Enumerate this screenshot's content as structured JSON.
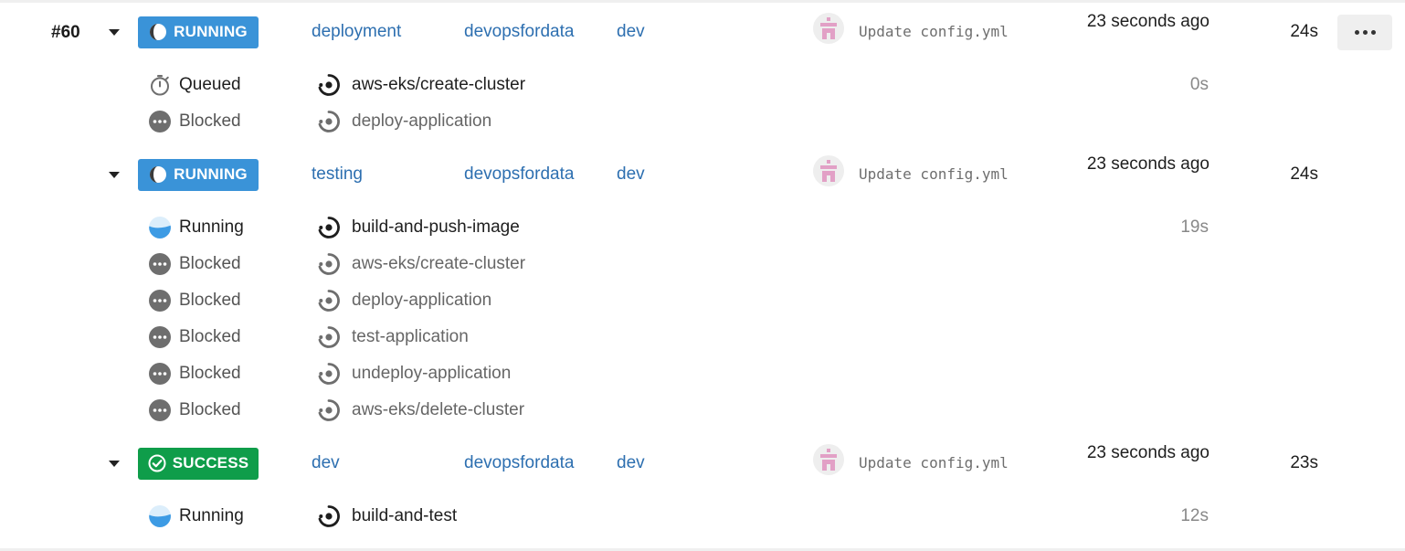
{
  "pipeline": {
    "number": "#60"
  },
  "workflows": [
    {
      "status": "RUNNING",
      "status_type": "running",
      "name": "deployment",
      "project": "devopsfordata",
      "branch": "dev",
      "commit_message": "Update config.yml",
      "time_ago": "23 seconds ago",
      "duration": "24s",
      "jobs": [
        {
          "status": "Queued",
          "status_icon": "stopwatch-icon",
          "name": "aws-eks/create-cluster",
          "duration": "0s",
          "active": true
        },
        {
          "status": "Blocked",
          "status_icon": "dots-circle-icon",
          "name": "deploy-application",
          "duration": "",
          "active": false
        }
      ]
    },
    {
      "status": "RUNNING",
      "status_type": "running",
      "name": "testing",
      "project": "devopsfordata",
      "branch": "dev",
      "commit_message": "Update config.yml",
      "time_ago": "23 seconds ago",
      "duration": "24s",
      "jobs": [
        {
          "status": "Running",
          "status_icon": "running-circle-icon",
          "name": "build-and-push-image",
          "duration": "19s",
          "active": true
        },
        {
          "status": "Blocked",
          "status_icon": "dots-circle-icon",
          "name": "aws-eks/create-cluster",
          "duration": "",
          "active": false
        },
        {
          "status": "Blocked",
          "status_icon": "dots-circle-icon",
          "name": "deploy-application",
          "duration": "",
          "active": false
        },
        {
          "status": "Blocked",
          "status_icon": "dots-circle-icon",
          "name": "test-application",
          "duration": "",
          "active": false
        },
        {
          "status": "Blocked",
          "status_icon": "dots-circle-icon",
          "name": "undeploy-application",
          "duration": "",
          "active": false
        },
        {
          "status": "Blocked",
          "status_icon": "dots-circle-icon",
          "name": "aws-eks/delete-cluster",
          "duration": "",
          "active": false
        }
      ]
    },
    {
      "status": "SUCCESS",
      "status_type": "success",
      "name": "dev",
      "project": "devopsfordata",
      "branch": "dev",
      "commit_message": "Update config.yml",
      "time_ago": "23 seconds ago",
      "duration": "23s",
      "jobs": [
        {
          "status": "Running",
          "status_icon": "running-circle-icon",
          "name": "build-and-test",
          "duration": "12s",
          "active": true
        }
      ]
    }
  ],
  "colors": {
    "running_badge": "#3a93d8",
    "success_badge": "#0f9d4a",
    "link": "#2d6fb0",
    "avatar_pink": "#e2a0c6"
  },
  "icons": {
    "more_actions": "more-horizontal-icon",
    "expand": "chevron-down-icon",
    "job": "job-circle-icon",
    "avatar": "identicon-avatar"
  }
}
